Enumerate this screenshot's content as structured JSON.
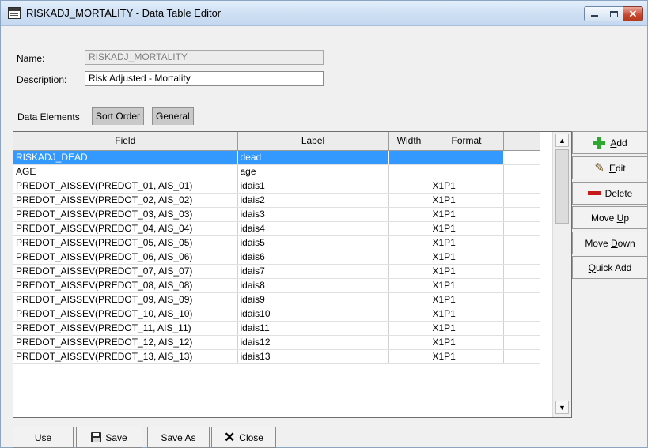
{
  "window": {
    "title": "RISKADJ_MORTALITY - Data Table Editor",
    "controls": {
      "minimize": "minimize-icon",
      "maximize": "maximize-icon",
      "close": "close-icon"
    }
  },
  "form": {
    "name_label": "Name:",
    "name_value": "RISKADJ_MORTALITY",
    "description_label": "Description:",
    "description_value": "Risk Adjusted - Mortality"
  },
  "tabs": [
    {
      "label": "Data Elements",
      "active": true
    },
    {
      "label": "Sort Order",
      "active": false
    },
    {
      "label": "General",
      "active": false
    }
  ],
  "grid": {
    "columns": [
      "Field",
      "Label",
      "Width",
      "Format"
    ],
    "rows": [
      {
        "field": "RISKADJ_DEAD",
        "label": "dead",
        "width": "",
        "format": "",
        "selected": true
      },
      {
        "field": "AGE",
        "label": "age",
        "width": "",
        "format": ""
      },
      {
        "field": "PREDOT_AISSEV(PREDOT_01, AIS_01)",
        "label": "idais1",
        "width": "",
        "format": "X1P1"
      },
      {
        "field": "PREDOT_AISSEV(PREDOT_02, AIS_02)",
        "label": "idais2",
        "width": "",
        "format": "X1P1"
      },
      {
        "field": "PREDOT_AISSEV(PREDOT_03, AIS_03)",
        "label": "idais3",
        "width": "",
        "format": "X1P1"
      },
      {
        "field": "PREDOT_AISSEV(PREDOT_04, AIS_04)",
        "label": "idais4",
        "width": "",
        "format": "X1P1"
      },
      {
        "field": "PREDOT_AISSEV(PREDOT_05, AIS_05)",
        "label": "idais5",
        "width": "",
        "format": "X1P1"
      },
      {
        "field": "PREDOT_AISSEV(PREDOT_06, AIS_06)",
        "label": "idais6",
        "width": "",
        "format": "X1P1"
      },
      {
        "field": "PREDOT_AISSEV(PREDOT_07, AIS_07)",
        "label": "idais7",
        "width": "",
        "format": "X1P1"
      },
      {
        "field": "PREDOT_AISSEV(PREDOT_08, AIS_08)",
        "label": "idais8",
        "width": "",
        "format": "X1P1"
      },
      {
        "field": "PREDOT_AISSEV(PREDOT_09, AIS_09)",
        "label": "idais9",
        "width": "",
        "format": "X1P1"
      },
      {
        "field": "PREDOT_AISSEV(PREDOT_10, AIS_10)",
        "label": "idais10",
        "width": "",
        "format": "X1P1"
      },
      {
        "field": "PREDOT_AISSEV(PREDOT_11, AIS_11)",
        "label": "idais11",
        "width": "",
        "format": "X1P1"
      },
      {
        "field": "PREDOT_AISSEV(PREDOT_12, AIS_12)",
        "label": "idais12",
        "width": "",
        "format": "X1P1"
      },
      {
        "field": "PREDOT_AISSEV(PREDOT_13, AIS_13)",
        "label": "idais13",
        "width": "",
        "format": "X1P1"
      }
    ]
  },
  "side_buttons": [
    {
      "name": "add-button",
      "text": "Add",
      "underline": "A",
      "icon": "plus-icon"
    },
    {
      "name": "edit-button",
      "text": "Edit",
      "underline": "E",
      "icon": "pencil-icon"
    },
    {
      "name": "delete-button",
      "text": "Delete",
      "underline": "D",
      "icon": "minus-icon"
    },
    {
      "name": "move-up-button",
      "text": "Move Up",
      "underline": "U",
      "icon": ""
    },
    {
      "name": "move-down-button",
      "text": "Move Down",
      "underline": "D",
      "icon": ""
    },
    {
      "name": "quick-add-button",
      "text": "Quick Add",
      "underline": "Q",
      "icon": ""
    }
  ],
  "bottom_buttons": [
    {
      "name": "use-button",
      "text": "Use",
      "underline": "U",
      "icon": ""
    },
    {
      "name": "save-button",
      "text": "Save",
      "underline": "S",
      "icon": "floppy-icon"
    },
    {
      "name": "save-as-button",
      "text": "Save As",
      "underline": "A",
      "icon": ""
    },
    {
      "name": "close-button",
      "text": "Close",
      "underline": "C",
      "icon": "x-icon"
    }
  ]
}
